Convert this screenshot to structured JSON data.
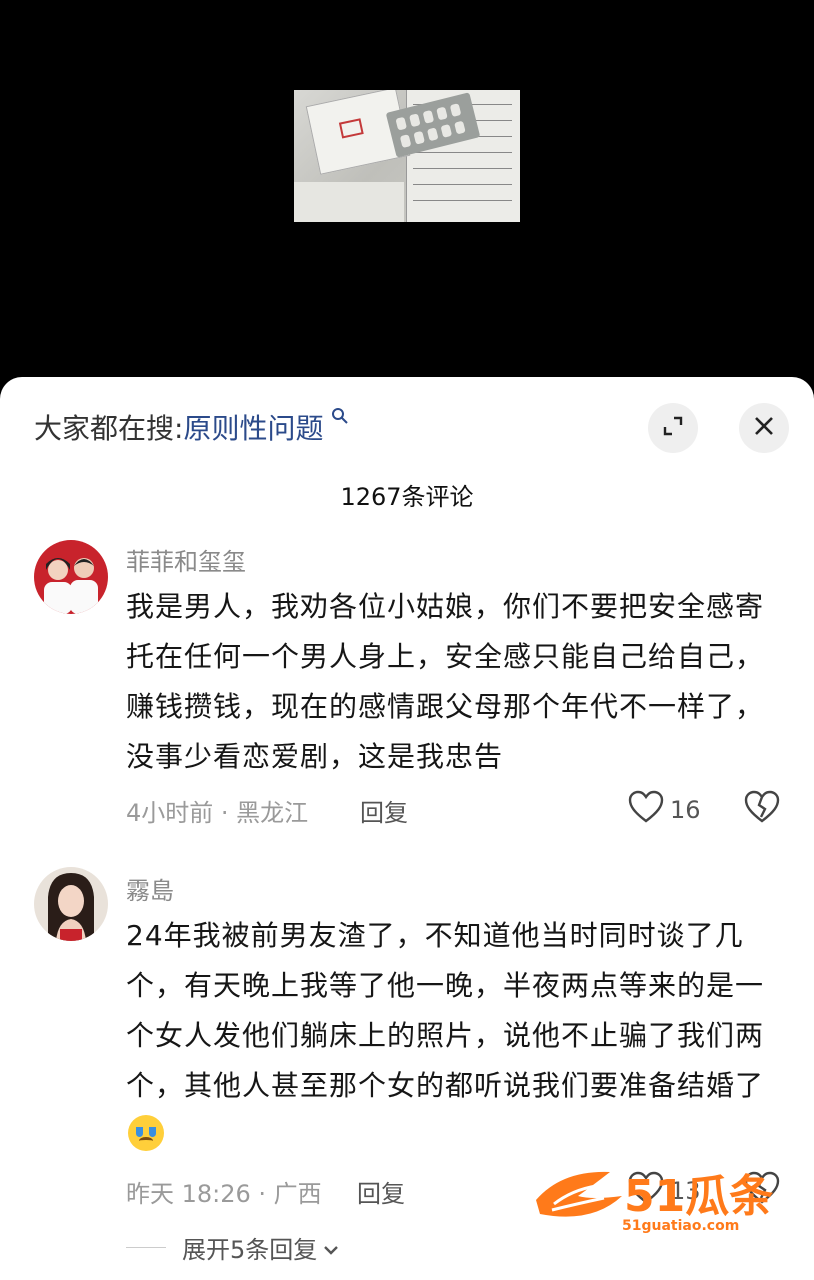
{
  "sheet": {
    "search_prefix": "大家都在搜:",
    "search_term": "原则性问题",
    "comment_count": "1267条评论"
  },
  "comments": [
    {
      "username": "菲菲和玺玺",
      "text": "我是男人，我劝各位小姑娘，你们不要把安全感寄托在任何一个男人身上，安全感只能自己给自己，赚钱攒钱，现在的感情跟父母那个年代不一样了，没事少看恋爱剧，这是我忠告",
      "meta": "4小时前 · 黑龙江",
      "reply_label": "回复",
      "likes": "16"
    },
    {
      "username": "霧島",
      "text": "24年我被前男友渣了，不知道他当时同时谈了几个，有天晚上我等了他一晚，半夜两点等来的是一个女人发他们躺床上的照片，说他不止骗了我们两个，其他人甚至那个女的都听说我们要准备结婚了",
      "meta": "昨天 18:26 · 广西",
      "reply_label": "回复",
      "likes": "13"
    }
  ],
  "expand_replies": "展开5条回复",
  "watermark": {
    "text": "51瓜条",
    "url": "51guatiao.com"
  },
  "colors": {
    "search_term": "#2b4a8a",
    "watermark": "#ff7a1a"
  },
  "icons": [
    "magnifier-icon",
    "expand-icon",
    "close-icon",
    "heart-icon",
    "broken-heart-icon",
    "chevron-down-icon"
  ]
}
